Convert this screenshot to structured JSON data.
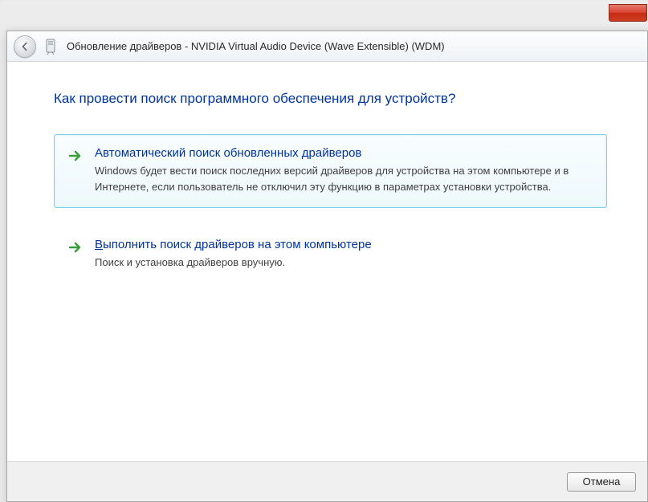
{
  "titlebar": {
    "title": "Обновление драйверов - NVIDIA Virtual Audio Device (Wave Extensible) (WDM)"
  },
  "heading": "Как провести поиск программного обеспечения для устройств?",
  "options": {
    "auto": {
      "title": "Автоматический поиск обновленных драйверов",
      "desc": "Windows будет вести поиск последних версий драйверов для устройства на этом компьютере и в Интернете, если пользователь не отключил эту функцию в параметрах установки устройства."
    },
    "manual": {
      "title_first": "В",
      "title_rest": "ыполнить поиск драйверов на этом компьютере",
      "desc": "Поиск и установка драйверов вручную."
    }
  },
  "footer": {
    "cancel": "Отмена"
  }
}
